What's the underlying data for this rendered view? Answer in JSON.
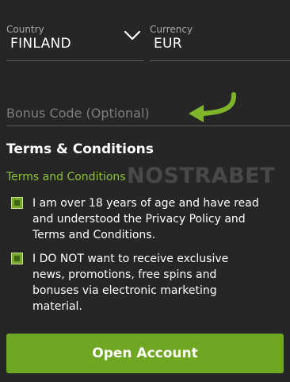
{
  "country": {
    "label": "Country",
    "value": "FINLAND"
  },
  "currency": {
    "label": "Currency",
    "value": "EUR"
  },
  "bonus": {
    "placeholder": "Bonus Code (Optional)"
  },
  "terms": {
    "heading": "Terms & Conditions",
    "link": "Terms and Conditions",
    "checkbox_age": "I am over 18 years of age and have read and understood the Privacy Policy and Terms and Conditions.",
    "checkbox_marketing": "I DO NOT want to receive exclusive news, promotions, free spins and bonuses via electronic marketing material."
  },
  "watermark": "NOSTRABET",
  "open_account_label": "Open Account",
  "colors": {
    "background": "#262626",
    "accent_green": "#8fc23a",
    "button_green": "#6fa722",
    "arrow_green": "#7fb52b"
  },
  "icons": {
    "country_dropdown": "chevron-down-icon",
    "pointer": "curved-arrow-icon"
  }
}
